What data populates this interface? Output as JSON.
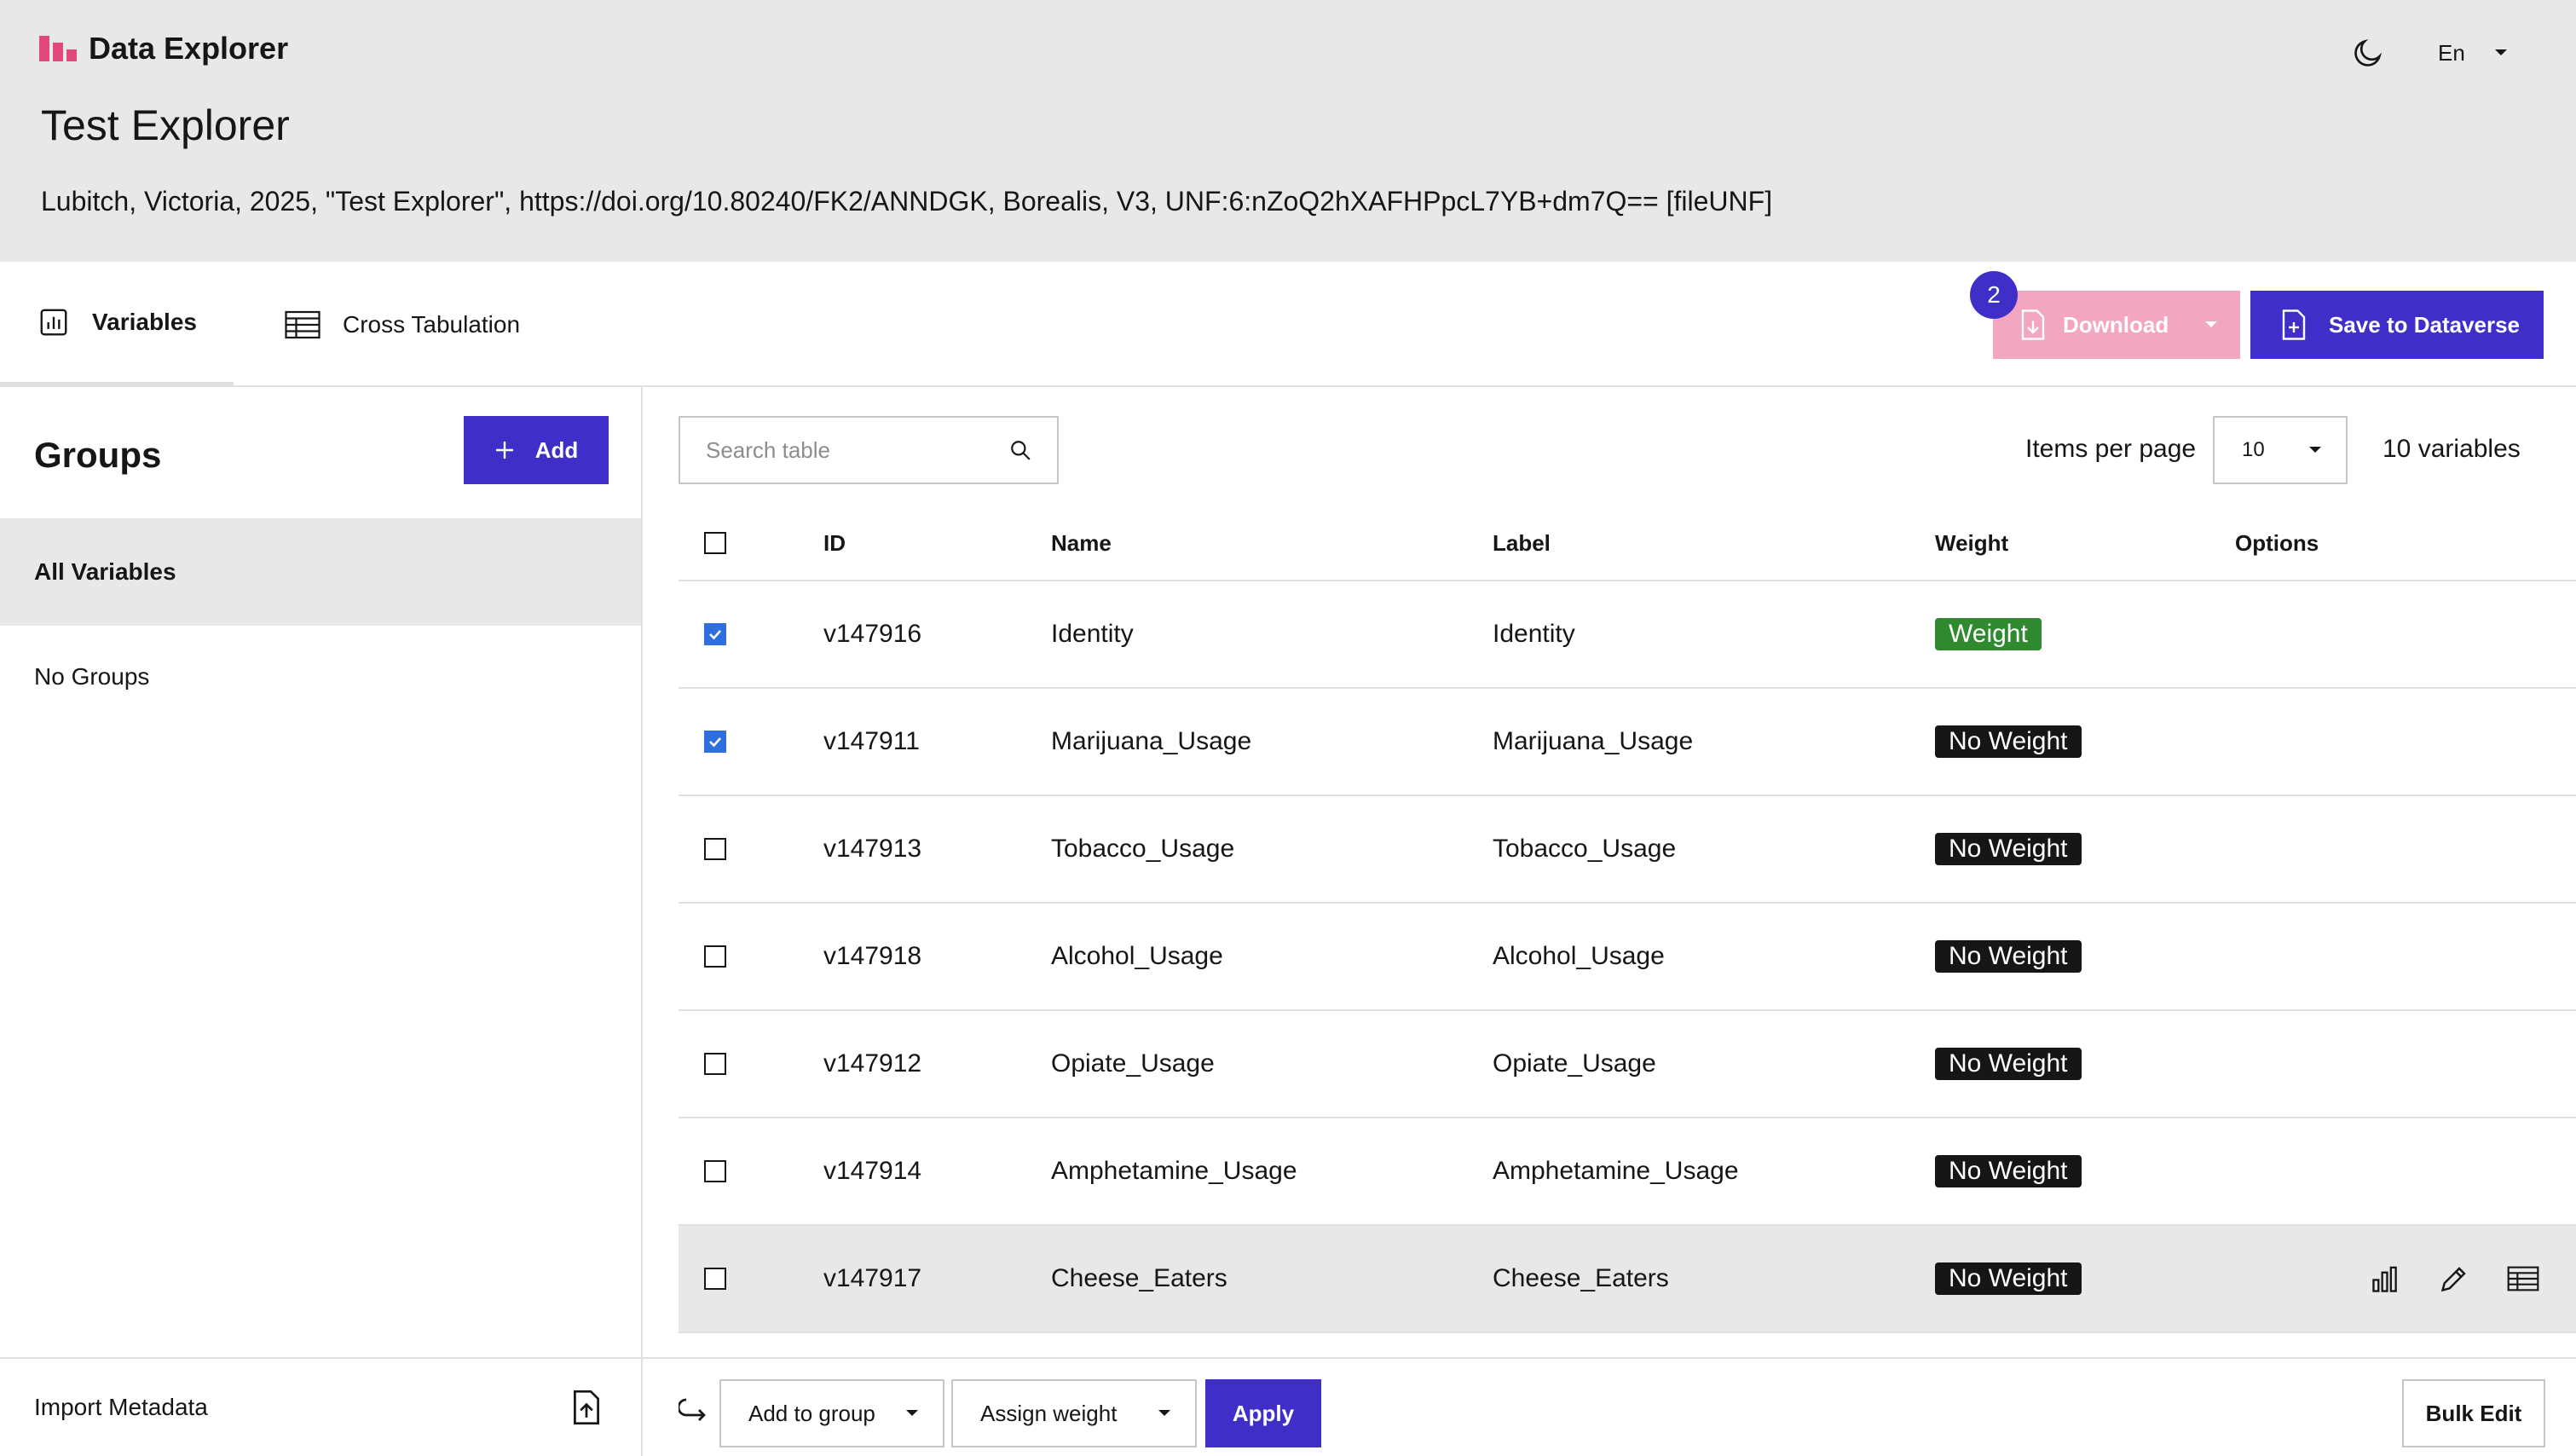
{
  "header": {
    "app_title": "Data Explorer",
    "language": "En",
    "page_title": "Test Explorer",
    "citation": "Lubitch, Victoria, 2025, \"Test Explorer\", https://doi.org/10.80240/FK2/ANNDGK, Borealis, V3, UNF:6:nZoQ2hXAFHPpcL7YB+dm7Q== [fileUNF]",
    "brand_color": "#e2487d"
  },
  "tabs": [
    {
      "label": "Variables",
      "icon": "bar-chart-icon",
      "selected": true
    },
    {
      "label": "Cross Tabulation",
      "icon": "table-icon",
      "selected": false
    }
  ],
  "toolbar": {
    "download_badge": "2",
    "download_label": "Download",
    "save_label": "Save to Dataverse"
  },
  "sidebar": {
    "groups_title": "Groups",
    "add_label": "Add",
    "all_variables_label": "All Variables",
    "no_groups_label": "No Groups",
    "import_label": "Import Metadata"
  },
  "main": {
    "search_placeholder": "Search table",
    "items_per_page_label": "Items per page",
    "items_per_page_value": "10",
    "variable_count": "10 variables",
    "columns": {
      "id": "ID",
      "name": "Name",
      "label": "Label",
      "weight": "Weight",
      "options": "Options"
    },
    "rows": [
      {
        "checked": true,
        "id": "v147916",
        "name": "Identity",
        "label": "Identity",
        "weight": "Weight",
        "is_weight": true
      },
      {
        "checked": true,
        "id": "v147911",
        "name": "Marijuana_Usage",
        "label": "Marijuana_Usage",
        "weight": "No Weight",
        "is_weight": false
      },
      {
        "checked": false,
        "id": "v147913",
        "name": "Tobacco_Usage",
        "label": "Tobacco_Usage",
        "weight": "No Weight",
        "is_weight": false
      },
      {
        "checked": false,
        "id": "v147918",
        "name": "Alcohol_Usage",
        "label": "Alcohol_Usage",
        "weight": "No Weight",
        "is_weight": false
      },
      {
        "checked": false,
        "id": "v147912",
        "name": "Opiate_Usage",
        "label": "Opiate_Usage",
        "weight": "No Weight",
        "is_weight": false
      },
      {
        "checked": false,
        "id": "v147914",
        "name": "Amphetamine_Usage",
        "label": "Amphetamine_Usage",
        "weight": "No Weight",
        "is_weight": false
      },
      {
        "checked": false,
        "id": "v147917",
        "name": "Cheese_Eaters",
        "label": "Cheese_Eaters",
        "weight": "No Weight",
        "is_weight": false
      }
    ]
  },
  "bottom_bar": {
    "add_to_group_label": "Add to group",
    "assign_weight_label": "Assign weight",
    "apply_label": "Apply",
    "bulk_edit_label": "Bulk Edit"
  },
  "colors": {
    "primary": "#3f2fc8",
    "download_disabled": "#f2a6c0",
    "checkbox_checked": "#2f6ee0",
    "weight_badge": "#2f8a2f",
    "no_weight_badge": "#161616"
  }
}
